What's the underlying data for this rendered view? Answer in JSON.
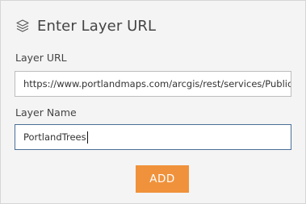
{
  "dialog": {
    "title": "Enter Layer URL",
    "icon": "layers-icon"
  },
  "fields": {
    "url_label": "Layer URL",
    "url_value": "https://www.portlandmaps.com/arcgis/rest/services/Public",
    "name_label": "Layer Name",
    "name_value": "PortlandTrees"
  },
  "actions": {
    "add_label": "ADD"
  },
  "colors": {
    "accent": "#f0923b",
    "panel_bg": "#f4f4f4",
    "focus_border": "#4a6e97"
  }
}
